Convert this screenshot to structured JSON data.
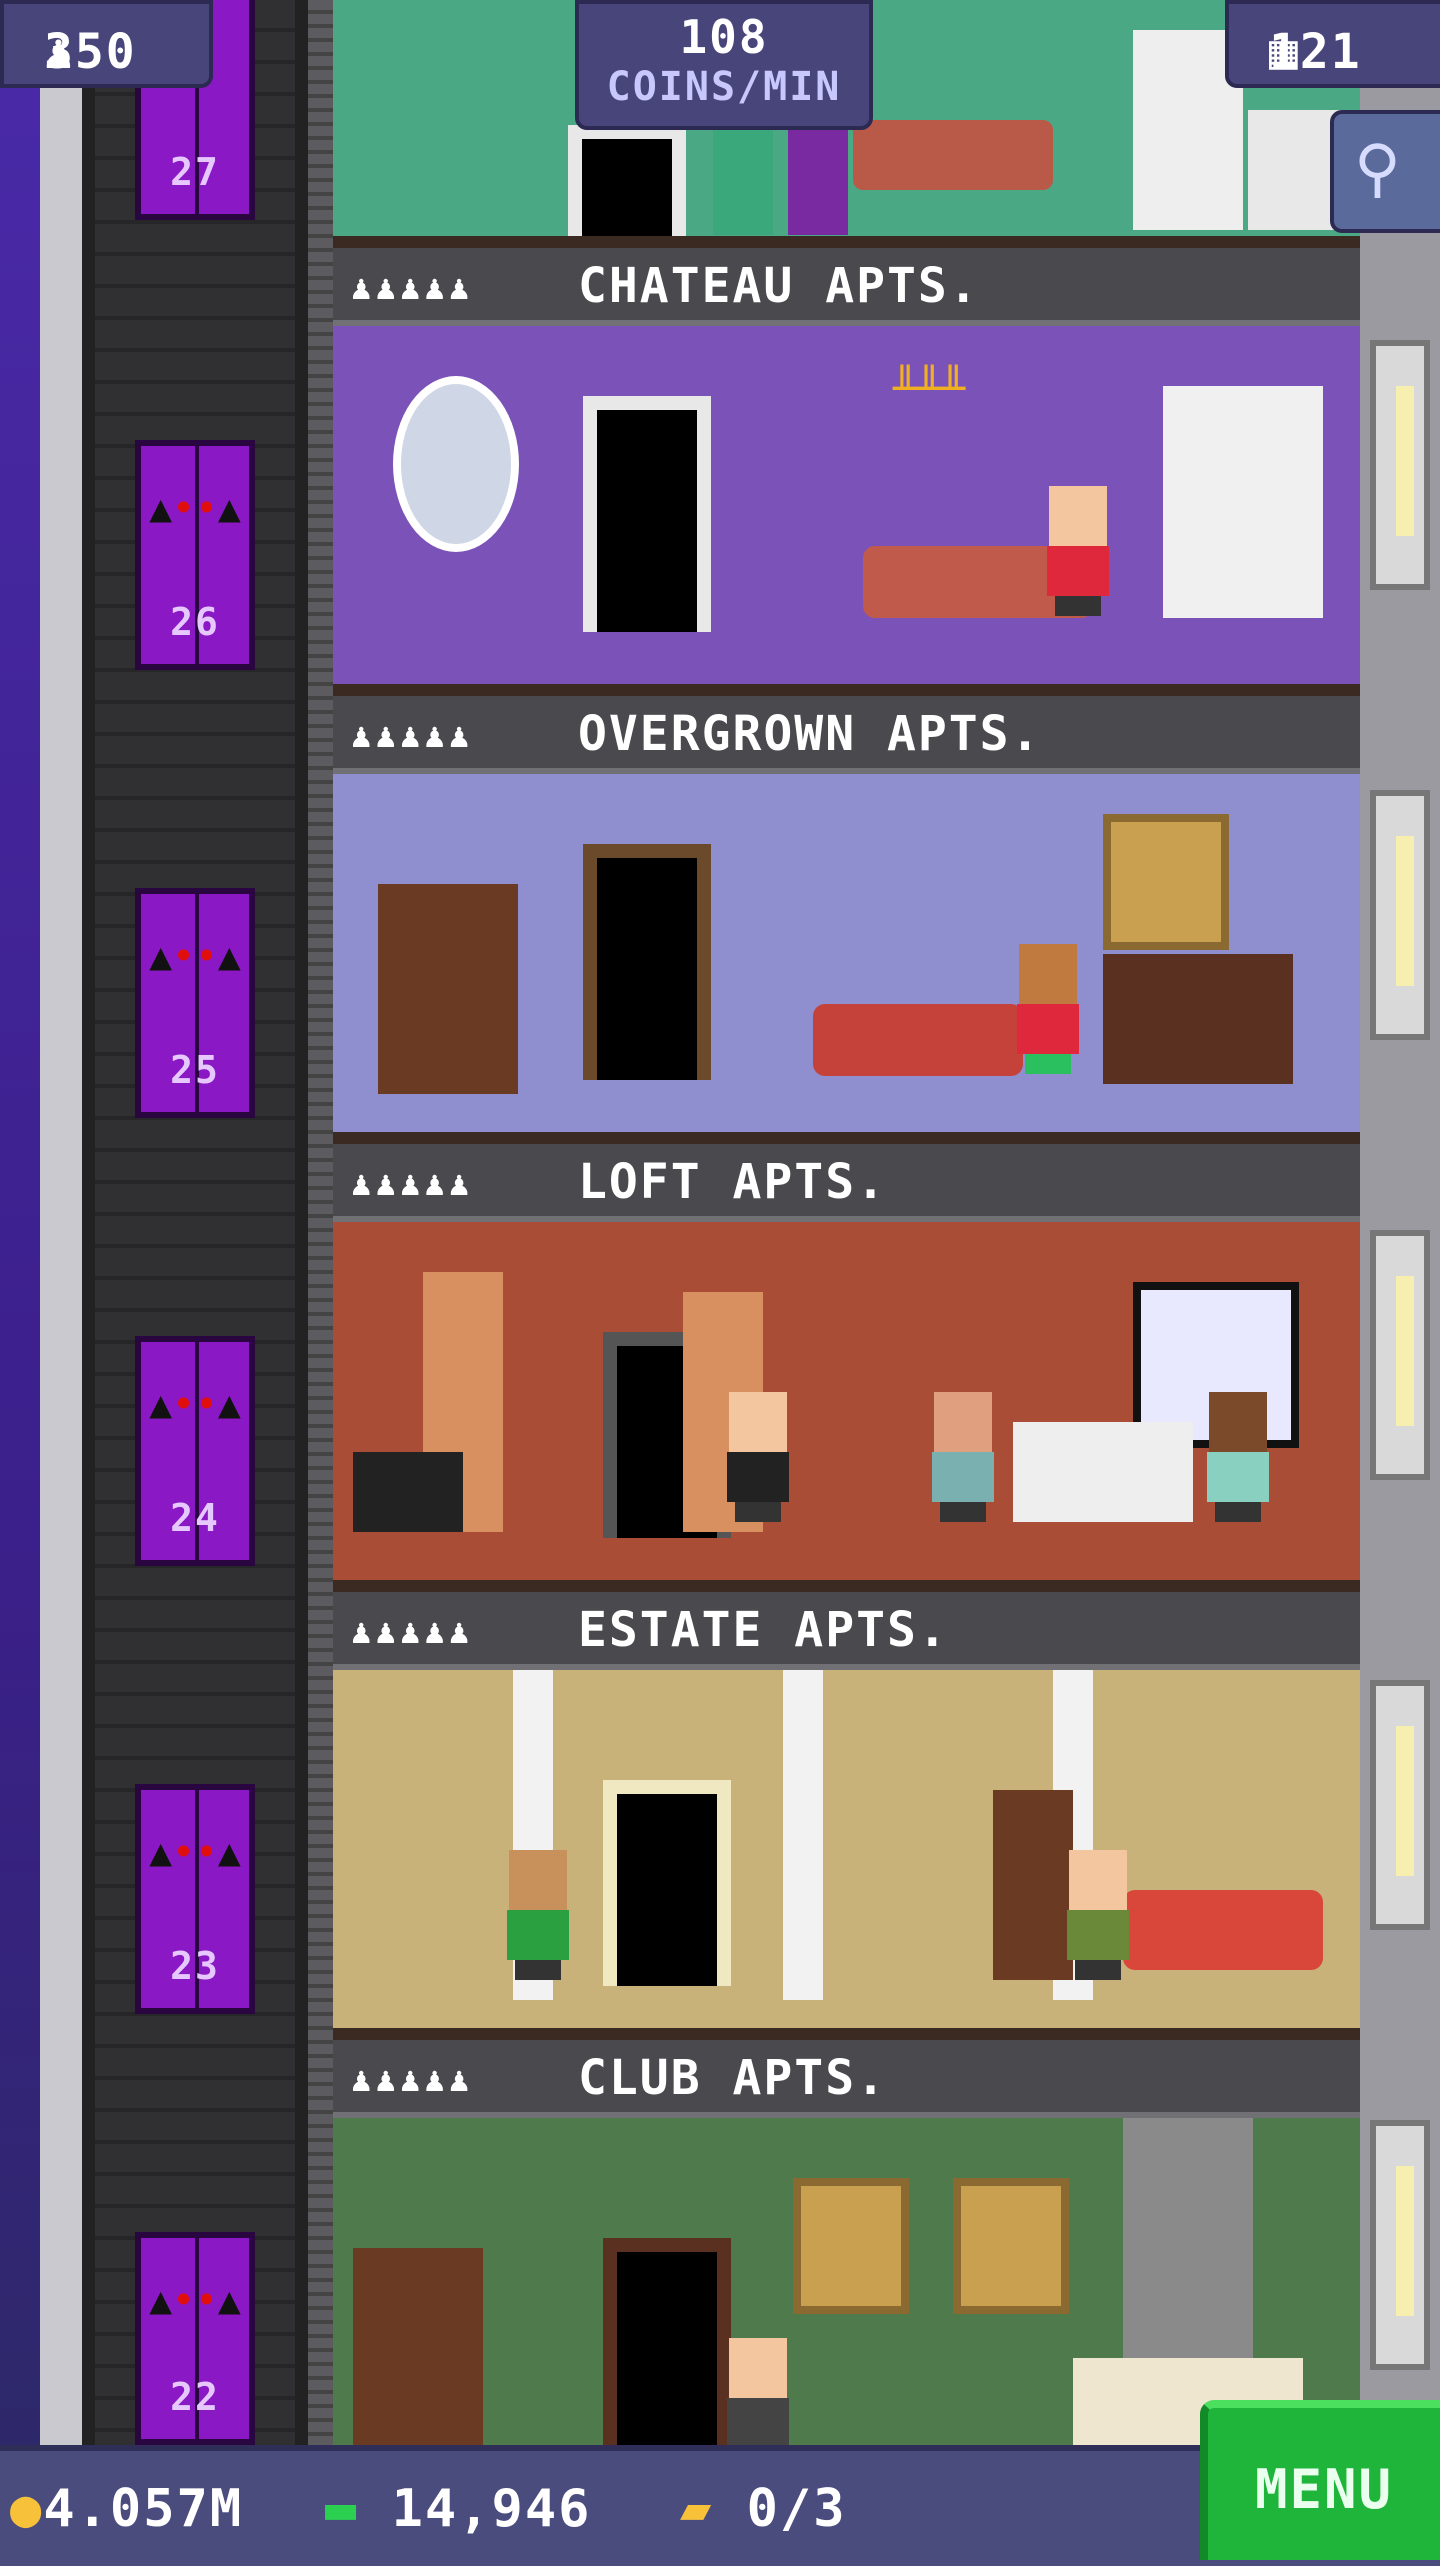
{
  "hud": {
    "population": "350",
    "coins_per_min_value": "108",
    "coins_per_min_label": "COINS/MIN",
    "floor_count": "121",
    "population_icon": "person-icon",
    "floors_icon": "building-icon",
    "search_icon": "magnifier-icon"
  },
  "elevator": {
    "floors": [
      "27",
      "26",
      "25",
      "24",
      "23",
      "22"
    ],
    "car_icon": "bat-icon"
  },
  "floors": [
    {
      "name": "CHATEAU APTS.",
      "occupancy": "♟♟♟♟♟"
    },
    {
      "name": "OVERGROWN APTS.",
      "occupancy": "♟♟♟♟♟"
    },
    {
      "name": "LOFT APTS.",
      "occupancy": "♟♟♟♟♟"
    },
    {
      "name": "ESTATE APTS.",
      "occupancy": "♟♟♟♟♟"
    },
    {
      "name": "CLUB APTS.",
      "occupancy": "♟♟♟♟♟"
    }
  ],
  "bottom_bar": {
    "coins": "4.057M",
    "bux": "14,946",
    "tickets": "0/3",
    "coin_icon": "coin-icon",
    "bux_icon": "cash-icon",
    "ticket_icon": "ticket-icon"
  },
  "menu_label": "MENU",
  "colors": {
    "elevator": "#8a18c4",
    "hud": "#48457a",
    "menu": "#1fb53a",
    "chateau_wall": "#7b52b8",
    "overgrown_wall": "#8f8fd0",
    "loft_wall": "#a94d36",
    "estate_wall": "#c8b27a",
    "club_wall": "#4f7a4c",
    "top_floor_wall": "#4aa884"
  }
}
